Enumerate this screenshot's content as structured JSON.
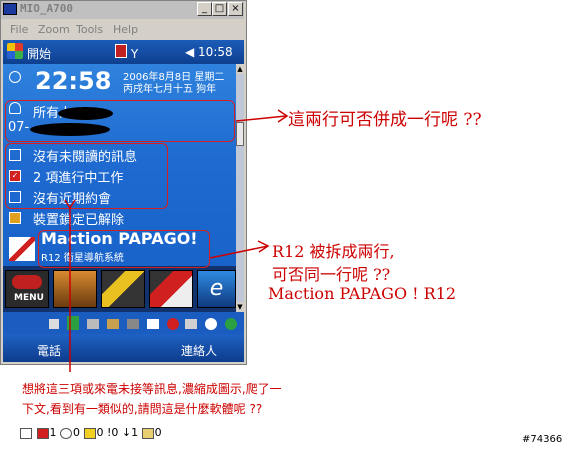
{
  "window": {
    "title": "MIO_A700",
    "buttons": {
      "minimize": "_",
      "maximize": "□",
      "close": "×"
    },
    "menu": [
      "File",
      "Zoom",
      "Tools",
      "Help"
    ]
  },
  "taskbar": {
    "start_label": "開始",
    "time": "◀ 10:58"
  },
  "today": {
    "big_time": "22:58",
    "date_line1": "2006年8月8日 星期二",
    "date_line2": "丙戌年七月十五 狗年",
    "owner_line1": "所有人: Vi",
    "owner_line2": "07-",
    "messages": "沒有未閱讀的訊息",
    "tasks": "2 項進行中工作",
    "appointments": "沒有近期約會",
    "lock": "裝置鎖定已解除",
    "papago_title": "Maction PAPAGO!",
    "papago_sub": "R12 衛星導航系統",
    "tile_menu_label": "MENU"
  },
  "softkeys": {
    "left": "電話",
    "right": "連絡人"
  },
  "annotations": {
    "a1": "這兩行可否併成一行呢 ??",
    "a2_line1": "R12 被拆成兩行,",
    "a2_line2": "可否同一行呢 ??",
    "a2_line3": "Maction PAPAGO ! R12",
    "a3_line1": "想將這三項或來電未接等訊息,濃縮成圖示,爬了一",
    "a3_line2": "下文,看到有一類似的,請問這是什麼軟體呢 ??"
  },
  "notif_strip": {
    "items": [
      "1",
      "0",
      "0",
      "!0",
      "↓1",
      "0"
    ]
  },
  "watermark": "#74366",
  "colors": {
    "annotation": "#cc0000",
    "screen_blue": "#1e64c8"
  }
}
